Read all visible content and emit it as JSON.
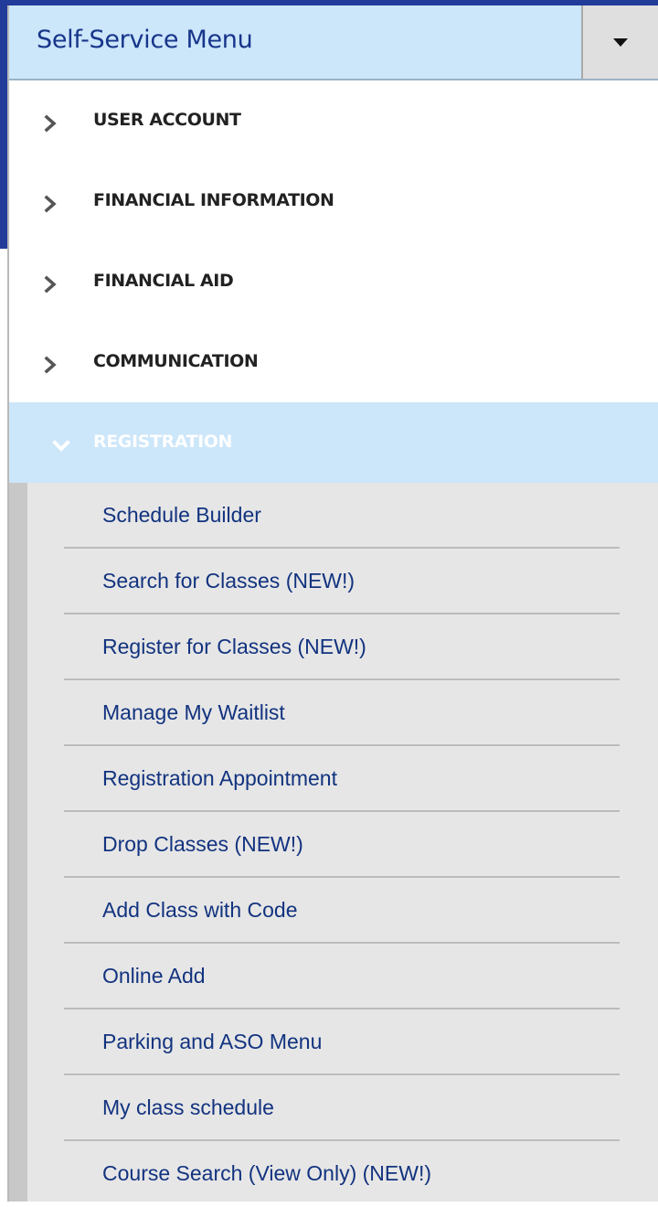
{
  "menu": {
    "title": "Self-Service Menu"
  },
  "categories": [
    {
      "label": "USER ACCOUNT"
    },
    {
      "label": "FINANCIAL INFORMATION"
    },
    {
      "label": "FINANCIAL AID"
    },
    {
      "label": "COMMUNICATION"
    },
    {
      "label": "REGISTRATION"
    }
  ],
  "registration_items": [
    {
      "label": "Schedule Builder"
    },
    {
      "label": "Search for Classes (NEW!)"
    },
    {
      "label": "Register for Classes (NEW!)"
    },
    {
      "label": "Manage My Waitlist"
    },
    {
      "label": "Registration Appointment"
    },
    {
      "label": "Drop Classes (NEW!)"
    },
    {
      "label": "Add Class with Code"
    },
    {
      "label": "Online Add"
    },
    {
      "label": "Parking and ASO Menu"
    },
    {
      "label": "My class schedule"
    },
    {
      "label": "Course Search (View Only) (NEW!)"
    }
  ],
  "colors": {
    "header_bg": "#cce6fa",
    "title_text": "#17358a",
    "link_text": "#12337f",
    "page_bg": "#223c9a"
  },
  "icons": {
    "collapsed": "chevron-right-icon",
    "expanded": "chevron-down-icon",
    "dropdown": "caret-down-icon"
  }
}
